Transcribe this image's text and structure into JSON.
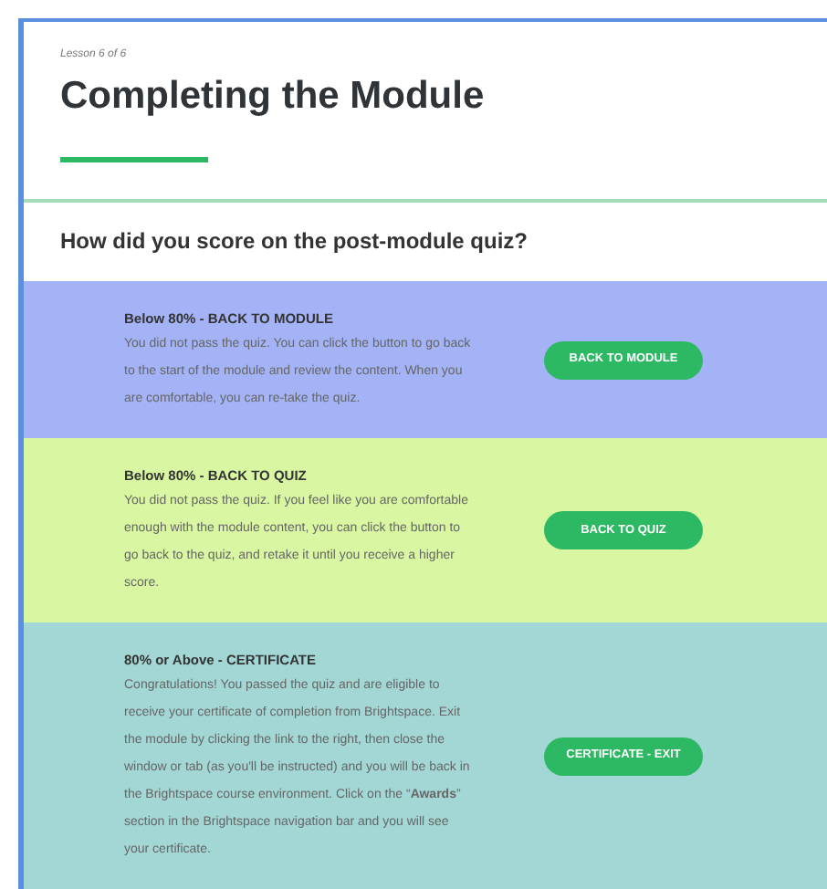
{
  "lesson_label": "Lesson 6 of 6",
  "title": "Completing the Module",
  "question": "How did you score on the post-module quiz?",
  "blocks": [
    {
      "heading": "Below 80% - BACK TO MODULE",
      "body": "You did not pass the quiz. You can click the button to go back to the start of the module and review the content. When you are comfortable, you can re-take the quiz.",
      "button": "BACK TO MODULE",
      "color": "#a3b3f5"
    },
    {
      "heading": "Below 80% - BACK TO QUIZ",
      "body": "You did not pass the quiz. If you feel like you are comfortable enough with the module content, you can click the button to go back to the quiz, and retake it until you receive a higher score.",
      "button": "BACK TO QUIZ",
      "color": "#d9f7a3"
    },
    {
      "heading": "80% or Above - CERTIFICATE",
      "body": "Congratulations! You passed the quiz and are eligible to receive your certificate of completion from Brightspace. Exit the module by clicking the link to the right, then close the window or tab (as you'll be instructed) and you will be back in the Brightspace course environment. Click on the “**Awards**” section in the Brightspace navigation bar and you will see your certificate.",
      "button": "CERTIFICATE - EXIT",
      "color": "#a3d7d5"
    }
  ]
}
